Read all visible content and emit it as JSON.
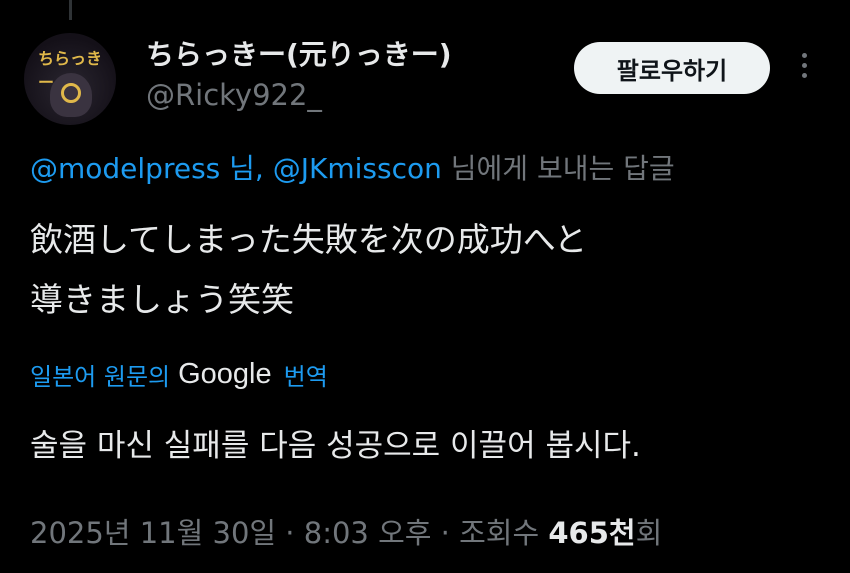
{
  "user": {
    "avatar_text": "ちらっきー",
    "display_name": "ちらっきー(元りっきー)",
    "handle": "@Ricky922_"
  },
  "follow_label": "팔로우하기",
  "reply_to": {
    "mention1": "@modelpress",
    "sep": " 님, ",
    "mention2": "@JKmisscon",
    "suffix": " 님에게 보내는 답글"
  },
  "tweet": {
    "line1": "飲酒してしまった失敗を次の成功へと",
    "line2": "導きましょう笑笑"
  },
  "translation": {
    "prefix": "일본어 원문의",
    "google": "Google",
    "suffix": "번역",
    "text": "술을 마신 실패를 다음 성공으로 이끌어 봅시다."
  },
  "meta": {
    "date": "2025년 11월 30일",
    "dot1": " · ",
    "time": "8:03 오후",
    "dot2": " · ",
    "views_label": "조회수 ",
    "views_count": "465천",
    "views_suffix": "회"
  },
  "colors": {
    "accent": "#1d9bf0",
    "muted": "#71767b",
    "background": "#000000"
  },
  "icons": {
    "more": "more-vertical-icon"
  }
}
